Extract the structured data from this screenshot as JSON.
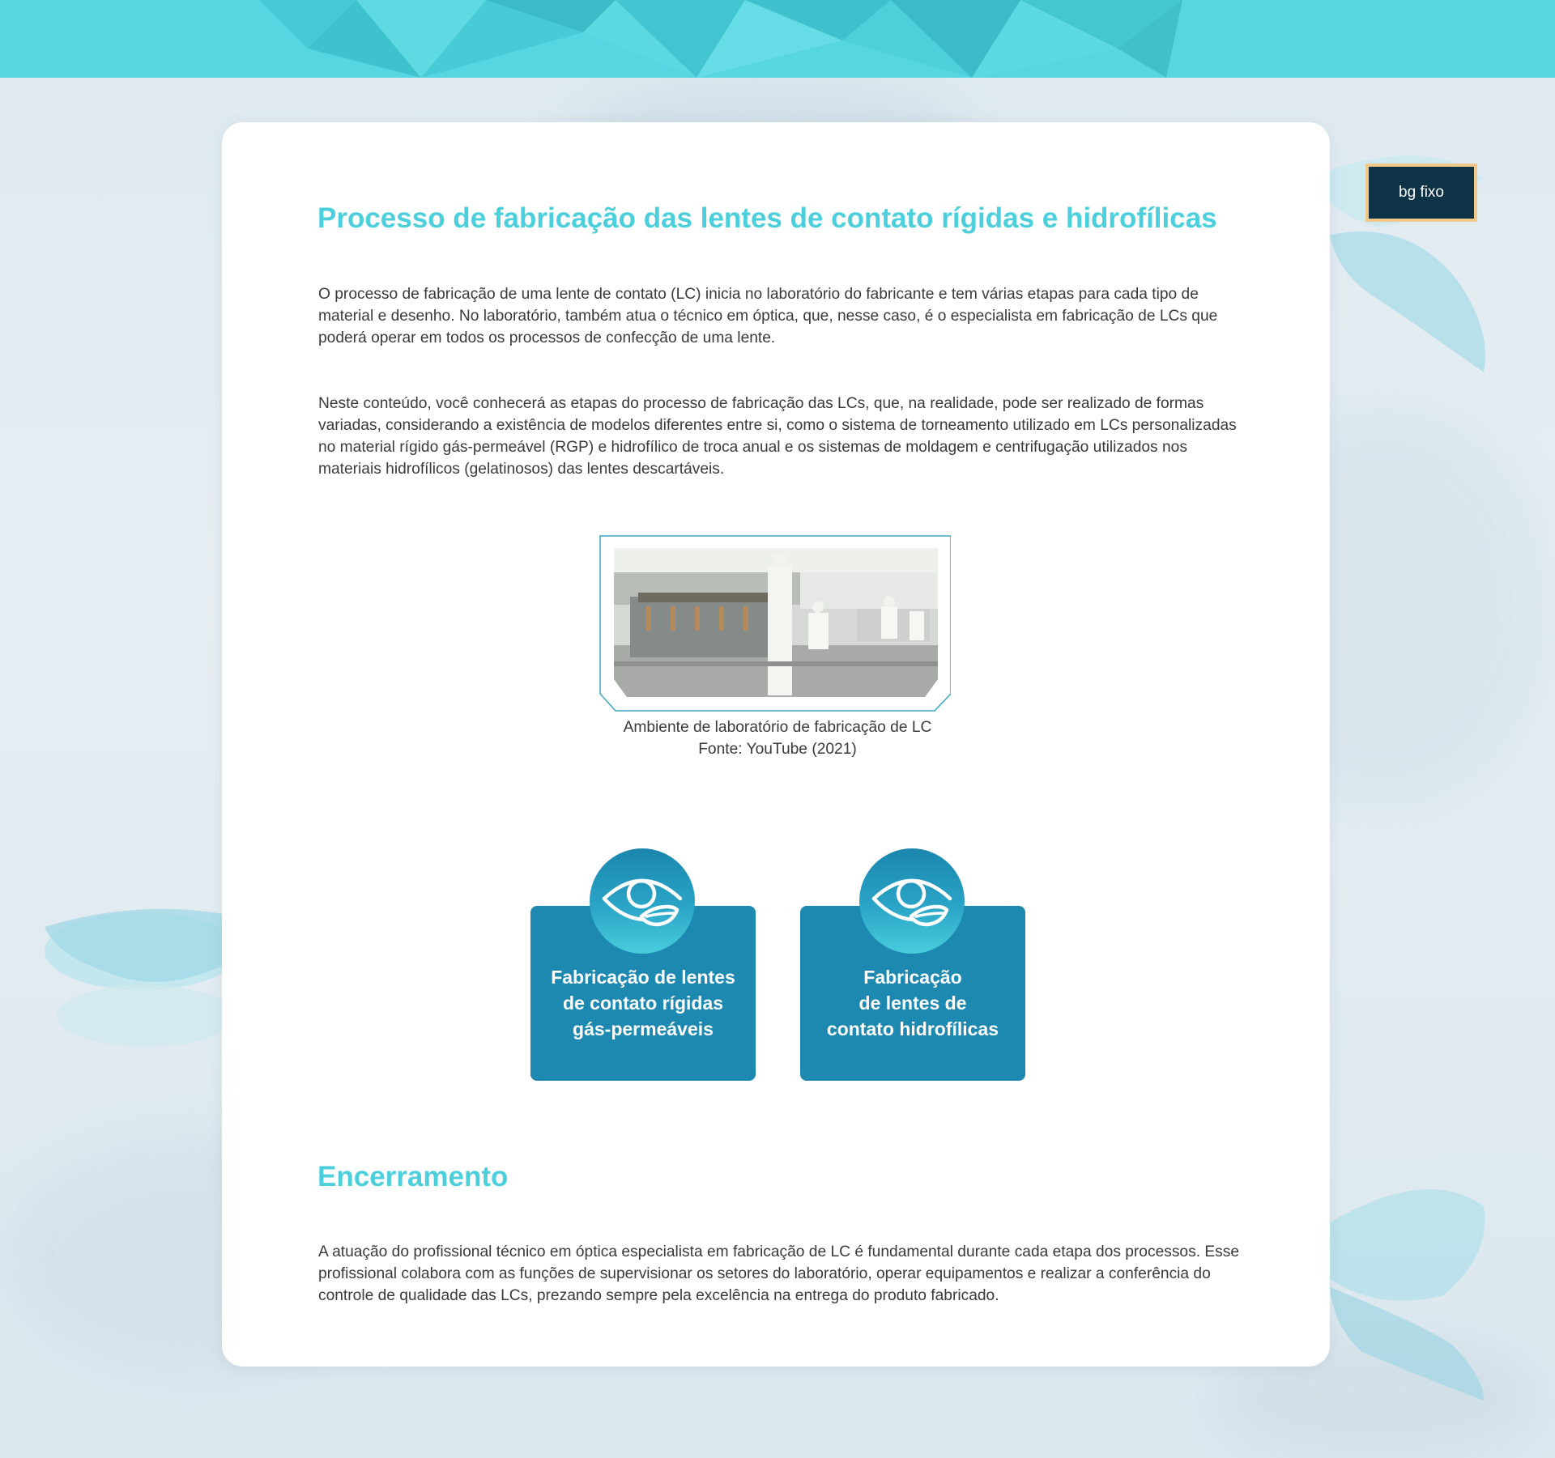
{
  "badge": {
    "label": "bg fixo"
  },
  "section1": {
    "title": "Processo de fabricação das lentes de contato rígidas e hidrofílicas",
    "paragraphs": [
      "O processo de fabricação de uma lente de contato (LC) inicia no laboratório do fabricante e tem várias etapas para cada tipo de material e desenho. No laboratório, também atua o técnico em óptica, que, nesse caso, é o especialista em fabricação de LCs que poderá operar em todos os processos de confecção de uma lente.",
      "Neste conteúdo, você conhecerá as etapas do processo de fabricação das LCs, que, na realidade, pode ser realizado de formas variadas, considerando a existência de modelos diferentes entre si, como o sistema de torneamento utilizado em LCs personalizadas no material rígido gás-permeável (RGP) e hidrofílico de troca anual e os sistemas de moldagem e centrifugação utilizados nos materiais hidrofílicos (gelatinosos) das lentes descartáveis."
    ]
  },
  "figure": {
    "caption": "Ambiente de laboratório de fabricação de LC",
    "source": "Fonte: YouTube (2021)"
  },
  "topics": [
    {
      "lines": [
        "Fabricação de lentes",
        "de contato rígidas",
        "gás-permeáveis"
      ],
      "icon": "eye-icon"
    },
    {
      "lines": [
        "Fabricação",
        "de lentes de",
        "contato hidrofílicas"
      ],
      "icon": "eye-icon"
    }
  ],
  "closing": {
    "title": "Encerramento",
    "paragraph": "A atuação do profissional técnico em óptica especialista em fabricação de LC é fundamental durante cada etapa dos processos. Esse profissional colabora com as funções de supervisionar os setores do laboratório, operar equipamentos e realizar a conferência do controle de qualidade das LCs, prezando sempre pela excelência na entrega do produto fabricado."
  },
  "colors": {
    "accent": "#4ccfdc",
    "card_blue": "#1d89b1",
    "badge_bg": "#0e3346",
    "badge_border": "#f0c98a",
    "top_band": "#56d6e0"
  }
}
